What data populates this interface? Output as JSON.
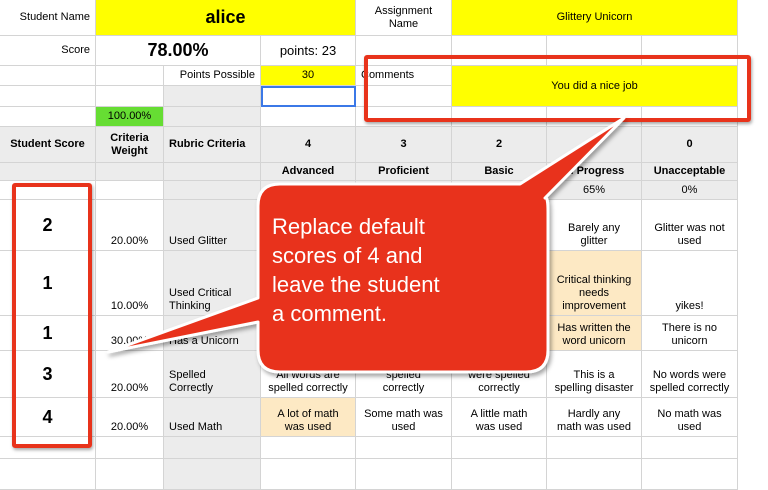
{
  "header": {
    "student_name_label": "Student Name",
    "student_name_value": "alice",
    "assignment_name_label": "Assignment\nName",
    "assignment_name_value": "Glittery Unicorn",
    "score_label": "Score",
    "score_value": "78.00%",
    "points_text": "points: 23",
    "points_possible_label": "Points Possible",
    "points_possible_value": "30",
    "comments_label": "Comments",
    "comment_value": "You did a nice job",
    "weight_total": "100.00%"
  },
  "columns": {
    "student_score": "Student Score",
    "criteria_weight": "Criteria\nWeight",
    "rubric_criteria": "Rubric Criteria",
    "levels": [
      {
        "score": "4",
        "label": "Advanced",
        "pct": ""
      },
      {
        "score": "3",
        "label": "Proficient",
        "pct": ""
      },
      {
        "score": "2",
        "label": "Basic",
        "pct": ""
      },
      {
        "score": "1",
        "label": "In Progress",
        "pct": "65%"
      },
      {
        "score": "0",
        "label": "Unacceptable",
        "pct": "0%"
      }
    ]
  },
  "rows": [
    {
      "score": "2",
      "weight": "20.00%",
      "criteria": "Used Glitter",
      "cells": [
        "",
        "",
        "ount of",
        "Barely any\nglitter",
        "Glitter was not\nused"
      ]
    },
    {
      "score": "1",
      "weight": "10.00%",
      "criteria": "Used Critical\nThinking",
      "cells": [
        "",
        "",
        "ical\nis\nd",
        "Critical thinking\nneeds\nimprovement",
        "yikes!"
      ]
    },
    {
      "score": "1",
      "weight": "30.00%",
      "criteria": "Has a Unicorn",
      "cells": [
        "",
        "",
        "mall\nn",
        "Has written the\nword unicorn",
        "There is no\nunicorn"
      ]
    },
    {
      "score": "3",
      "weight": "20.00%",
      "criteria": "Spelled\nCorrectly",
      "cells": "X",
      "cells_list": [
        "All words are\nspelled correctly",
        "Most words\nspelled\ncorrectly",
        "Some words\nwere spelled\ncorrectly",
        "This is a\nspelling disaster",
        "No words were\nspelled correctly"
      ]
    },
    {
      "score": "4",
      "weight": "20.00%",
      "criteria": "Used Math",
      "cells": [
        "A lot of math\nwas used",
        "Some math was\nused",
        "A little math\nwas used",
        "Hardly any\nmath was used",
        "No math was\nused"
      ]
    }
  ],
  "callout": {
    "lines": [
      "Replace default",
      "scores of 4 and",
      "leave the student",
      "a comment."
    ]
  },
  "colors": {
    "highlight": "#ffff00",
    "weight_ok": "#66dd33",
    "selected": "#fde9c4",
    "annotation": "#e8331b"
  }
}
